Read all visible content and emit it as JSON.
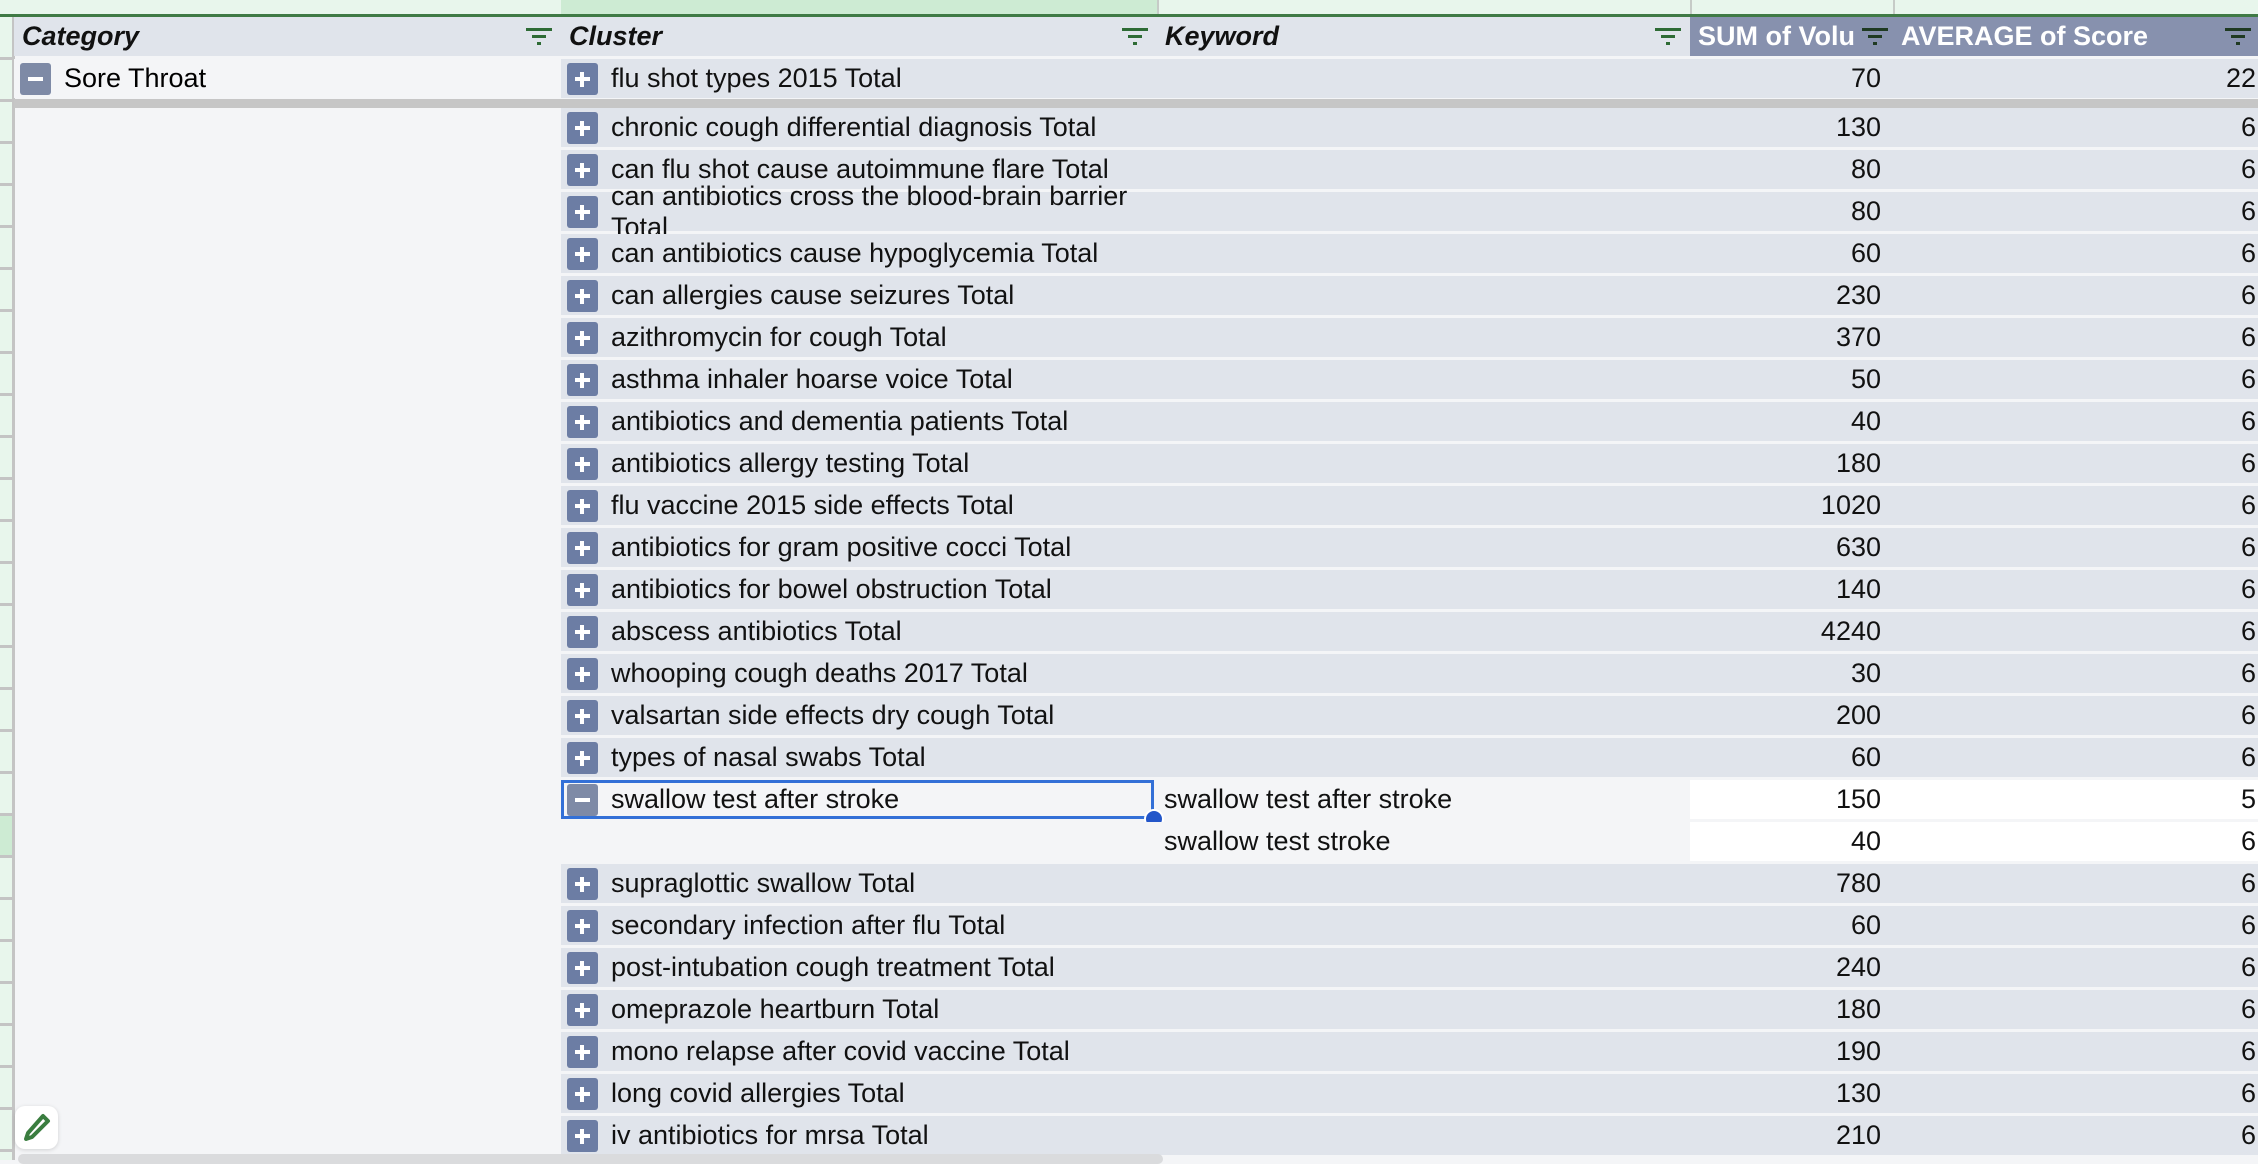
{
  "headers": {
    "category": "Category",
    "cluster": "Cluster",
    "keyword": "Keyword",
    "sum_volume": "SUM of Volu",
    "avg_score": "AVERAGE of Score"
  },
  "category_row": {
    "label": "Sore Throat",
    "toggle": "collapse"
  },
  "rows": [
    {
      "cluster": "flu shot types 2015 Total",
      "keyword": "",
      "sum": "70",
      "avg": "22"
    },
    {
      "cluster": "chronic cough differential diagnosis Total",
      "keyword": "",
      "sum": "130",
      "avg": "6"
    },
    {
      "cluster": "can flu shot cause autoimmune flare Total",
      "keyword": "",
      "sum": "80",
      "avg": "6"
    },
    {
      "cluster": "can antibiotics cross the blood-brain barrier Total",
      "keyword": "",
      "sum": "80",
      "avg": "6"
    },
    {
      "cluster": "can antibiotics cause hypoglycemia Total",
      "keyword": "",
      "sum": "60",
      "avg": "6"
    },
    {
      "cluster": "can allergies cause seizures Total",
      "keyword": "",
      "sum": "230",
      "avg": "6"
    },
    {
      "cluster": "azithromycin for cough Total",
      "keyword": "",
      "sum": "370",
      "avg": "6"
    },
    {
      "cluster": "asthma inhaler hoarse voice Total",
      "keyword": "",
      "sum": "50",
      "avg": "6"
    },
    {
      "cluster": "antibiotics and dementia patients Total",
      "keyword": "",
      "sum": "40",
      "avg": "6"
    },
    {
      "cluster": "antibiotics allergy testing Total",
      "keyword": "",
      "sum": "180",
      "avg": "6"
    },
    {
      "cluster": "flu vaccine 2015 side effects Total",
      "keyword": "",
      "sum": "1020",
      "avg": "6"
    },
    {
      "cluster": "antibiotics for gram positive cocci Total",
      "keyword": "",
      "sum": "630",
      "avg": "6"
    },
    {
      "cluster": "antibiotics for bowel obstruction Total",
      "keyword": "",
      "sum": "140",
      "avg": "6"
    },
    {
      "cluster": "abscess antibiotics Total",
      "keyword": "",
      "sum": "4240",
      "avg": "6"
    },
    {
      "cluster": "whooping cough deaths 2017 Total",
      "keyword": "",
      "sum": "30",
      "avg": "6"
    },
    {
      "cluster": "valsartan side effects dry cough Total",
      "keyword": "",
      "sum": "200",
      "avg": "6"
    },
    {
      "cluster": "types of nasal swabs Total",
      "keyword": "",
      "sum": "60",
      "avg": "6"
    },
    {
      "cluster": "swallow test after stroke",
      "keyword": "swallow test after stroke",
      "sum": "150",
      "avg": "5",
      "expanded": true,
      "selected": true
    },
    {
      "cluster": "",
      "keyword": "swallow test stroke",
      "sum": "40",
      "avg": "6",
      "child": true
    },
    {
      "cluster": "supraglottic swallow Total",
      "keyword": "",
      "sum": "780",
      "avg": "6"
    },
    {
      "cluster": "secondary infection after flu Total",
      "keyword": "",
      "sum": "60",
      "avg": "6"
    },
    {
      "cluster": "post-intubation cough treatment Total",
      "keyword": "",
      "sum": "240",
      "avg": "6"
    },
    {
      "cluster": "omeprazole heartburn Total",
      "keyword": "",
      "sum": "180",
      "avg": "6"
    },
    {
      "cluster": "mono relapse after covid vaccine Total",
      "keyword": "",
      "sum": "190",
      "avg": "6"
    },
    {
      "cluster": "long covid allergies Total",
      "keyword": "",
      "sum": "130",
      "avg": "6"
    },
    {
      "cluster": "iv antibiotics for mrsa Total",
      "keyword": "",
      "sum": "210",
      "avg": "6"
    }
  ],
  "colors": {
    "header_bg": "#e0e4eb",
    "value_header_bg": "#8791ae",
    "toggle_button": "#6c7da4",
    "selection": "#3370d7",
    "filter_icon": "#2e6b35"
  },
  "icons": {
    "filter": "filter-icon",
    "expand": "plus-box-icon",
    "collapse": "minus-box-icon",
    "edit": "pencil-icon"
  }
}
